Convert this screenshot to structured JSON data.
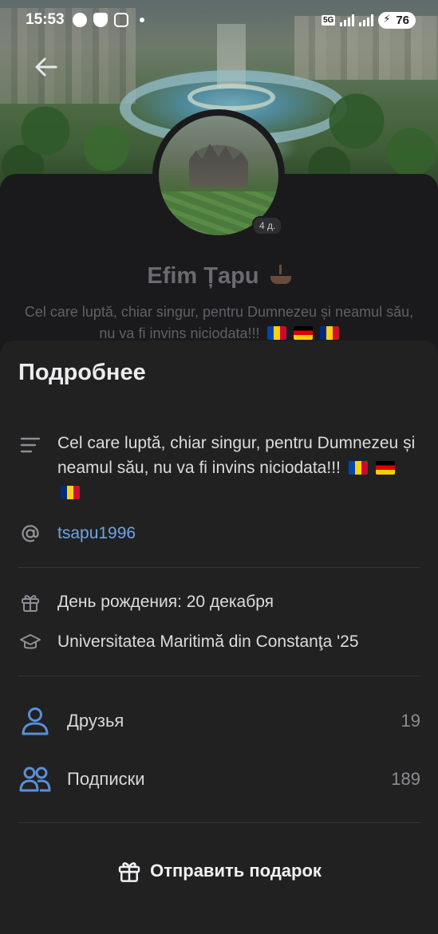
{
  "status_bar": {
    "time": "15:53",
    "network_tag": "5G",
    "battery": "76"
  },
  "profile": {
    "story_age": "4 д.",
    "name": "Efim Țapu",
    "bio": "Cel care luptă, chiar singur, pentru Dumnezeu și neamul său, nu va fi invins niciodata!!!"
  },
  "sheet": {
    "title": "Подробнее",
    "about_text": "Cel care luptă, chiar singur, pentru Dumnezeu și neamul său, nu va fi invins niciodata!!!",
    "username": "tsapu1996",
    "birthday": "День рождения: 20 декабря",
    "education": "Universitatea Maritimă din Constanţa '25",
    "friends_label": "Друзья",
    "friends_count": "19",
    "subscriptions_label": "Подписки",
    "subscriptions_count": "189",
    "gift_button_label": "Отправить подарок"
  },
  "colors": {
    "background": "#1b1b1d",
    "sheet": "#212122",
    "accent": "#6fa3e5",
    "icon_blue": "#5b8fd6"
  },
  "icons": {
    "back": "arrow-left-icon",
    "about": "text-lines-icon",
    "username": "at-sign-icon",
    "birthday": "gift-icon",
    "education": "graduation-cap-icon",
    "friends": "person-icon",
    "subscriptions": "people-icon",
    "gift_button": "gift-icon"
  }
}
